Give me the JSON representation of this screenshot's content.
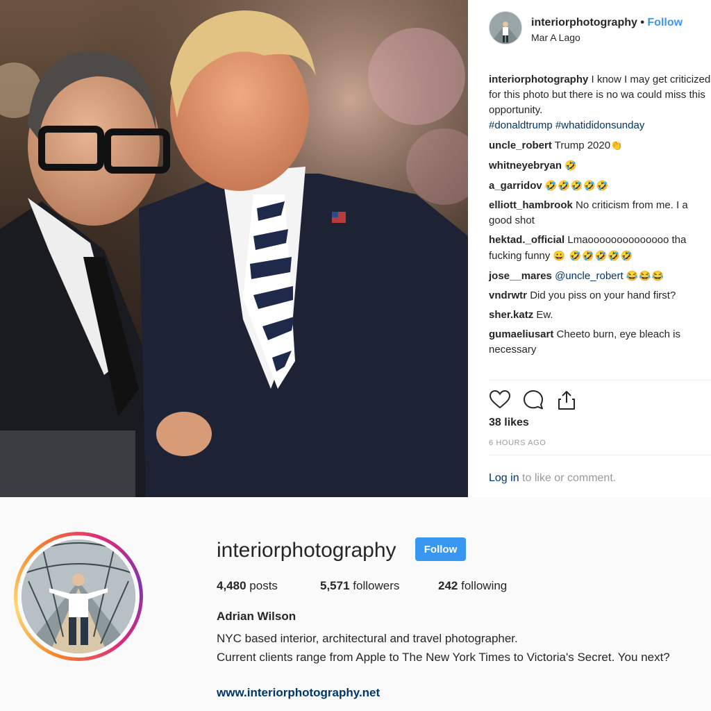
{
  "post": {
    "username": "interiorphotography",
    "separator": "•",
    "follow_label": "Follow",
    "location": "Mar A Lago",
    "caption": {
      "username": "interiorphotography",
      "text": "I know I may get criticized for this photo but there is no wa could miss this opportunity.",
      "hashtags": "#donaldtrump #whatididonsunday"
    },
    "comments": [
      {
        "user": "uncle_robert",
        "text": "Trump 2020",
        "emoji": "👏"
      },
      {
        "user": "whitneyebryan",
        "text": "",
        "emoji": "🤣"
      },
      {
        "user": "a_garridov",
        "text": "",
        "emoji": "🤣🤣🤣🤣🤣"
      },
      {
        "user": "elliott_hambrook",
        "text": "No criticism from me. I a good shot",
        "emoji": ""
      },
      {
        "user": "hektad._official",
        "text": "Lmaoooooooooooooo tha fucking funny",
        "emoji": "😀 🤣🤣🤣🤣🤣"
      },
      {
        "user": "jose__mares",
        "text": "@uncle_robert",
        "emoji": "😂😂😂"
      },
      {
        "user": "vndrwtr",
        "text": "Did you piss on your hand first?",
        "emoji": ""
      },
      {
        "user": "sher.katz",
        "text": "Ew.",
        "emoji": ""
      },
      {
        "user": "gumaeliusart",
        "text": "Cheeto burn, eye bleach is necessary",
        "emoji": ""
      }
    ],
    "icons": {
      "like": "heart-icon",
      "comment": "comment-icon",
      "share": "share-icon"
    },
    "likes": "38 likes",
    "time_ago": "6 HOURS AGO",
    "login_link": "Log in",
    "login_text": "to like or comment."
  },
  "profile": {
    "username": "interiorphotography",
    "follow_label": "Follow",
    "posts_count": "4,480",
    "posts_label": "posts",
    "followers_count": "5,571",
    "followers_label": "followers",
    "following_count": "242",
    "following_label": "following",
    "full_name": "Adrian Wilson",
    "bio_line1": "NYC based interior, architectural and travel photographer.",
    "bio_line2": "Current clients range from Apple to The New York Times to Victoria's Secret. You next?",
    "website": "www.interiorphotography.net"
  },
  "colors": {
    "accent": "#3897f0",
    "link": "#003569",
    "muted": "#999999"
  }
}
